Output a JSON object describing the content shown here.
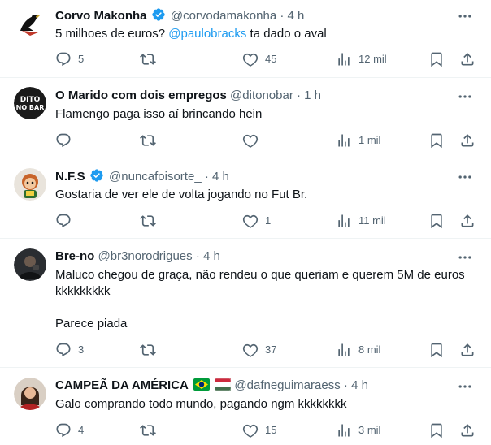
{
  "tweets": [
    {
      "name": "Corvo Makonha",
      "verified": true,
      "handle": "@corvodamakonha",
      "time": "4 h",
      "text_before": "5 milhoes de euros? ",
      "mention": "@paulobracks",
      "text_after": " ta dado o aval",
      "replies": "5",
      "retweets": "",
      "likes": "45",
      "views": "12 mil"
    },
    {
      "name": "O Marido com dois empregos",
      "verified": false,
      "handle": "@ditonobar",
      "time": "1 h",
      "text": "Flamengo paga isso aí brincando hein",
      "replies": "",
      "retweets": "",
      "likes": "",
      "views": "1 mil",
      "avatar_text_line1": "DITO",
      "avatar_text_line2": "NO BAR"
    },
    {
      "name": "N.F.S",
      "verified": true,
      "handle": "@nuncafoisorte_",
      "time": "4 h",
      "text": "Gostaria de ver ele de volta jogando no Fut Br.",
      "replies": "",
      "retweets": "",
      "likes": "1",
      "views": "11 mil"
    },
    {
      "name": "Bre-no",
      "verified": false,
      "handle": "@br3norodrigues",
      "time": "4 h",
      "text": "Maluco chegou de graça, não rendeu o que queriam e querem 5M de euros\nkkkkkkkkk\n\nParece piada",
      "replies": "3",
      "retweets": "",
      "likes": "37",
      "views": "8 mil"
    },
    {
      "name": "CAMPEÃ DA AMÉRICA",
      "verified": false,
      "handle": "@dafneguimaraess",
      "time": "4 h",
      "text": "Galo comprando todo mundo, pagando ngm kkkkkkkk",
      "replies": "4",
      "retweets": "",
      "likes": "15",
      "views": "3 mil"
    }
  ],
  "ui": {
    "separator": "·",
    "accent": "#1d9bf0",
    "muted": "#536471"
  }
}
